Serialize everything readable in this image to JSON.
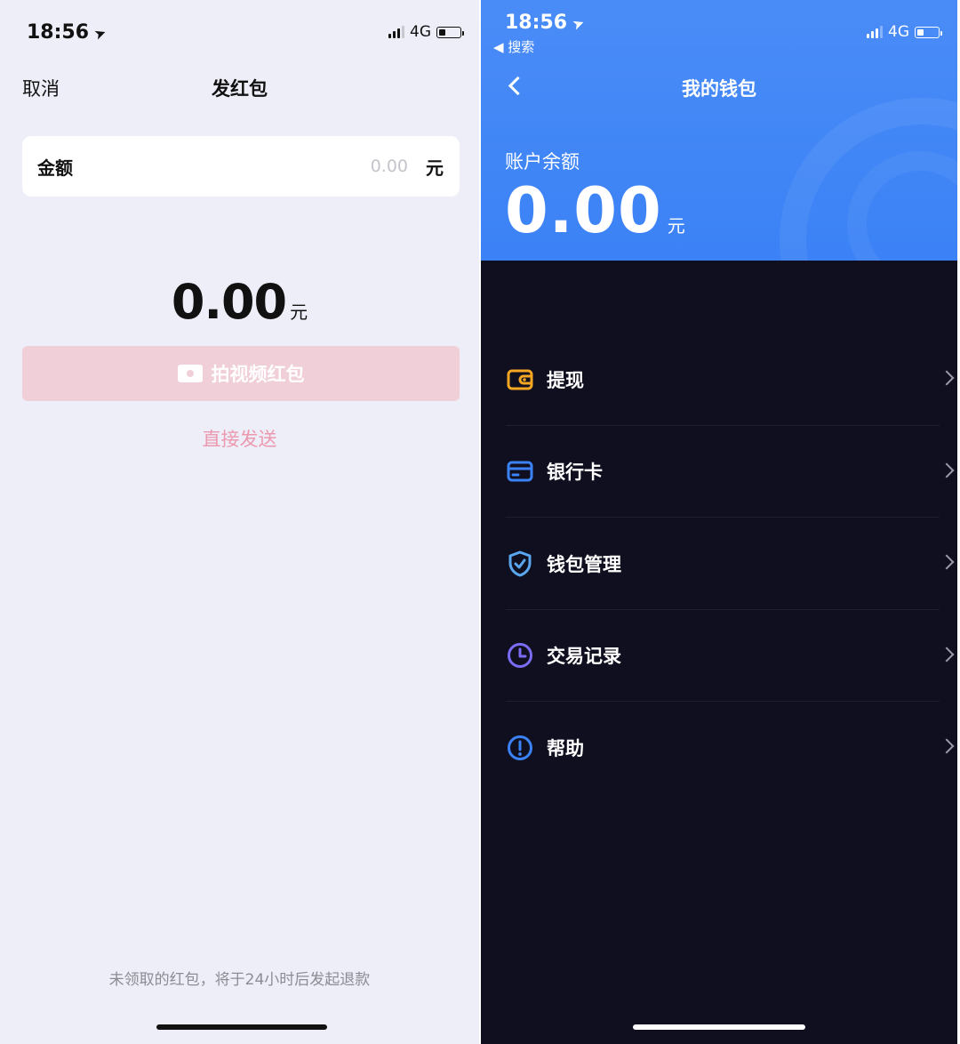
{
  "left": {
    "status": {
      "time": "18:56",
      "network": "4G"
    },
    "nav": {
      "cancel": "取消",
      "title": "发红包"
    },
    "amount_field": {
      "label": "金额",
      "placeholder": "0.00",
      "value": "",
      "unit": "元"
    },
    "total": {
      "amount": "0.00",
      "unit": "元"
    },
    "video_button": {
      "label": "拍视频红包"
    },
    "direct_send": {
      "label": "直接发送"
    },
    "footer_note": "未领取的红包，将于24小时后发起退款"
  },
  "right": {
    "status": {
      "time": "18:56",
      "network": "4G",
      "back_app": "◀ 搜索"
    },
    "nav": {
      "title": "我的钱包"
    },
    "balance": {
      "label": "账户余额",
      "amount": "0.00",
      "unit": "元"
    },
    "menu": [
      {
        "label": "提现",
        "icon": "wallet-icon",
        "color": "#f5a623"
      },
      {
        "label": "银行卡",
        "icon": "bank-card-icon",
        "color": "#3b82f6"
      },
      {
        "label": "钱包管理",
        "icon": "shield-check-icon",
        "color": "#5aa7f0"
      },
      {
        "label": "交易记录",
        "icon": "clock-icon",
        "color": "#7b6cf6"
      },
      {
        "label": "帮助",
        "icon": "info-icon",
        "color": "#3b82f6"
      }
    ]
  },
  "colors": {
    "left_bg": "#eeeef8",
    "right_bg": "#0f0f1f",
    "header_blue": "#4a8cf7",
    "video_button_disabled": "#f0cfd8",
    "direct_send_pink": "#ec98ae"
  }
}
